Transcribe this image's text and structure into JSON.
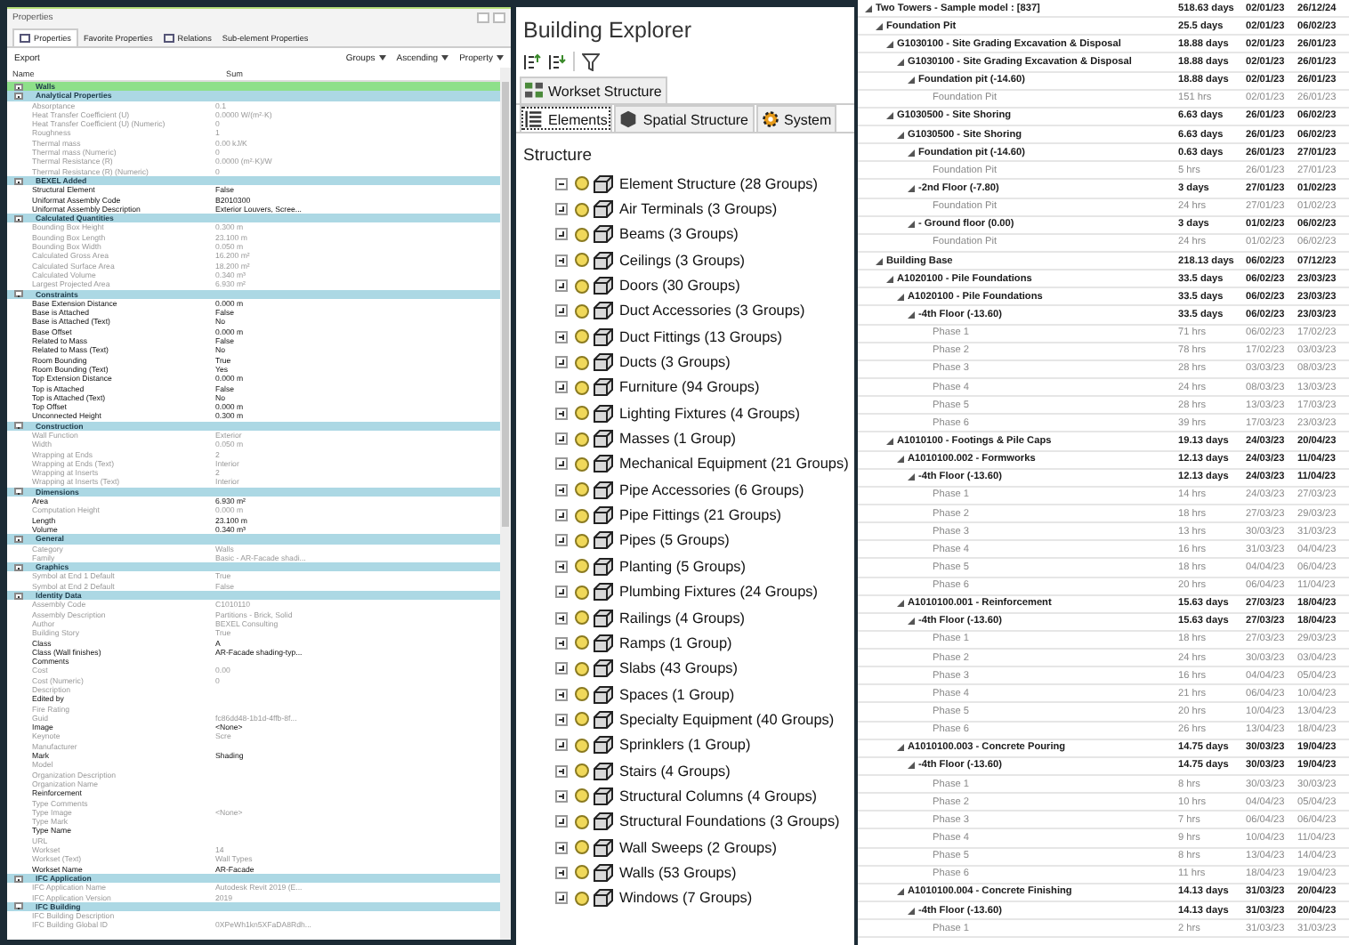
{
  "properties_panel": {
    "title": "Properties",
    "tabs": [
      {
        "label": "Properties",
        "selected": true
      },
      {
        "label": "Favorite Properties",
        "selected": false
      },
      {
        "label": "Relations",
        "selected": false
      },
      {
        "label": "Sub-element Properties",
        "selected": false
      }
    ],
    "export": "Export",
    "tools": [
      "Groups",
      "Ascending",
      "Property"
    ],
    "columns": [
      "Name",
      "Sum"
    ],
    "rows": [
      {
        "kind": "group",
        "label": "Walls",
        "color": "#8ee08a",
        "expanded": true
      },
      {
        "kind": "group",
        "label": "Analytical Properties",
        "color": "#acd8e4",
        "expanded": true
      },
      {
        "kind": "property",
        "name": "Absorptance",
        "value": "0.1",
        "disabled": true
      },
      {
        "kind": "property",
        "name": "Heat Transfer Coefficient (U)",
        "value": "0.0000 W/(m²·K)",
        "disabled": true
      },
      {
        "kind": "property",
        "name": "Heat Transfer Coefficient (U) (Numeric)",
        "value": "0",
        "disabled": true
      },
      {
        "kind": "property",
        "name": "Roughness",
        "value": "1",
        "disabled": true
      },
      {
        "kind": "property",
        "name": "Thermal mass",
        "value": "0.00 kJ/K",
        "disabled": true
      },
      {
        "kind": "property",
        "name": "Thermal mass (Numeric)",
        "value": "0",
        "disabled": true
      },
      {
        "kind": "property",
        "name": "Thermal Resistance (R)",
        "value": "0.0000 (m²·K)/W",
        "disabled": true
      },
      {
        "kind": "property",
        "name": "Thermal Resistance (R) (Numeric)",
        "value": "0",
        "disabled": true
      },
      {
        "kind": "group",
        "label": "BEXEL Added",
        "color": "#acd8e4",
        "expanded": true
      },
      {
        "kind": "property",
        "name": "Structural Element",
        "value": "False",
        "disabled": false
      },
      {
        "kind": "property",
        "name": "Uniformat Assembly Code",
        "value": "B2010300",
        "disabled": false
      },
      {
        "kind": "property",
        "name": "Uniformat Assembly Description",
        "value": "Exterior Louvers, Scree...",
        "disabled": false
      },
      {
        "kind": "group",
        "label": "Calculated Quantities",
        "color": "#acd8e4",
        "expanded": true
      },
      {
        "kind": "property",
        "name": "Bounding Box Height",
        "value": "0.300 m",
        "disabled": true
      },
      {
        "kind": "property",
        "name": "Bounding Box Length",
        "value": "23.100 m",
        "disabled": true
      },
      {
        "kind": "property",
        "name": "Bounding Box Width",
        "value": "0.050 m",
        "disabled": true
      },
      {
        "kind": "property",
        "name": "Calculated Gross Area",
        "value": "16.200 m²",
        "disabled": true
      },
      {
        "kind": "property",
        "name": "Calculated Surface Area",
        "value": "18.200 m²",
        "disabled": true
      },
      {
        "kind": "property",
        "name": "Calculated Volume",
        "value": "0.340 m³",
        "disabled": true
      },
      {
        "kind": "property",
        "name": "Largest Projected Area",
        "value": "6.930 m²",
        "disabled": true
      },
      {
        "kind": "group",
        "label": "Constraints",
        "color": "#acd8e4",
        "expanded": true
      },
      {
        "kind": "property",
        "name": "Base Extension Distance",
        "value": "0.000 m",
        "disabled": false
      },
      {
        "kind": "property",
        "name": "Base is Attached",
        "value": "False",
        "disabled": false
      },
      {
        "kind": "property",
        "name": "Base is Attached (Text)",
        "value": "No",
        "disabled": false
      },
      {
        "kind": "property",
        "name": "Base Offset",
        "value": "0.000 m",
        "disabled": false
      },
      {
        "kind": "property",
        "name": "Related to Mass",
        "value": "False",
        "disabled": false
      },
      {
        "kind": "property",
        "name": "Related to Mass (Text)",
        "value": "No",
        "disabled": false
      },
      {
        "kind": "property",
        "name": "Room Bounding",
        "value": "True",
        "disabled": false
      },
      {
        "kind": "property",
        "name": "Room Bounding (Text)",
        "value": "Yes",
        "disabled": false
      },
      {
        "kind": "property",
        "name": "Top Extension Distance",
        "value": "0.000 m",
        "disabled": false
      },
      {
        "kind": "property",
        "name": "Top is Attached",
        "value": "False",
        "disabled": false
      },
      {
        "kind": "property",
        "name": "Top is Attached (Text)",
        "value": "No",
        "disabled": false
      },
      {
        "kind": "property",
        "name": "Top Offset",
        "value": "0.000 m",
        "disabled": false
      },
      {
        "kind": "property",
        "name": "Unconnected Height",
        "value": "0.300 m",
        "disabled": false
      },
      {
        "kind": "group",
        "label": "Construction",
        "color": "#acd8e4",
        "expanded": true
      },
      {
        "kind": "property",
        "name": "Wall Function",
        "value": "Exterior",
        "disabled": true
      },
      {
        "kind": "property",
        "name": "Width",
        "value": "0.050 m",
        "disabled": true
      },
      {
        "kind": "property",
        "name": "Wrapping at Ends",
        "value": "2",
        "disabled": true
      },
      {
        "kind": "property",
        "name": "Wrapping at Ends (Text)",
        "value": "Interior",
        "disabled": true
      },
      {
        "kind": "property",
        "name": "Wrapping at Inserts",
        "value": "2",
        "disabled": true
      },
      {
        "kind": "property",
        "name": "Wrapping at Inserts (Text)",
        "value": "Interior",
        "disabled": true
      },
      {
        "kind": "group",
        "label": "Dimensions",
        "color": "#acd8e4",
        "expanded": true
      },
      {
        "kind": "property",
        "name": "Area",
        "value": "6.930 m²",
        "disabled": false
      },
      {
        "kind": "property",
        "name": "Computation Height",
        "value": "0.000 m",
        "disabled": true
      },
      {
        "kind": "property",
        "name": "Length",
        "value": "23.100 m",
        "disabled": false
      },
      {
        "kind": "property",
        "name": "Volume",
        "value": "0.340 m³",
        "disabled": false
      },
      {
        "kind": "group",
        "label": "General",
        "color": "#acd8e4",
        "expanded": true
      },
      {
        "kind": "property",
        "name": "Category",
        "value": "Walls",
        "disabled": true
      },
      {
        "kind": "property",
        "name": "Family",
        "value": "Basic - AR-Facade shadi...",
        "disabled": true
      },
      {
        "kind": "group",
        "label": "Graphics",
        "color": "#acd8e4",
        "expanded": true
      },
      {
        "kind": "property",
        "name": "Symbol at End 1 Default",
        "value": "True",
        "disabled": true
      },
      {
        "kind": "property",
        "name": "Symbol at End 2 Default",
        "value": "False",
        "disabled": true
      },
      {
        "kind": "group",
        "label": "Identity Data",
        "color": "#acd8e4",
        "expanded": true
      },
      {
        "kind": "property",
        "name": "Assembly Code",
        "value": "C1010110",
        "disabled": true
      },
      {
        "kind": "property",
        "name": "Assembly Description",
        "value": "Partitions - Brick, Solid",
        "disabled": true
      },
      {
        "kind": "property",
        "name": "Author",
        "value": "BEXEL Consulting",
        "disabled": true
      },
      {
        "kind": "property",
        "name": "Building Story",
        "value": "True",
        "disabled": true
      },
      {
        "kind": "property",
        "name": "Class",
        "value": "A",
        "disabled": false
      },
      {
        "kind": "property",
        "name": "Class (Wall finishes)",
        "value": "AR-Facade shading-typ...",
        "disabled": false
      },
      {
        "kind": "property",
        "name": "Comments",
        "disabled": false
      },
      {
        "kind": "property",
        "name": "Cost",
        "value": "0.00",
        "disabled": true
      },
      {
        "kind": "property",
        "name": "Cost (Numeric)",
        "value": "0",
        "disabled": true
      },
      {
        "kind": "property",
        "name": "Description",
        "disabled": true
      },
      {
        "kind": "property",
        "name": "Edited by",
        "disabled": false
      },
      {
        "kind": "property",
        "name": "Fire Rating",
        "disabled": true
      },
      {
        "kind": "property",
        "name": "Guid",
        "value": "fc86dd48-1b1d-4ffb-8f...",
        "disabled": true
      },
      {
        "kind": "property",
        "name": "Image",
        "value": "<None>",
        "disabled": false
      },
      {
        "kind": "property",
        "name": "Keynote",
        "value": "Scre",
        "disabled": true
      },
      {
        "kind": "property",
        "name": "Manufacturer",
        "disabled": true
      },
      {
        "kind": "property",
        "name": "Mark",
        "value": "Shading",
        "disabled": false
      },
      {
        "kind": "property",
        "name": "Model",
        "disabled": true
      },
      {
        "kind": "property",
        "name": "Organization Description",
        "disabled": true
      },
      {
        "kind": "property",
        "name": "Organization Name",
        "disabled": true
      },
      {
        "kind": "property",
        "name": "Reinforcement",
        "disabled": false
      },
      {
        "kind": "property",
        "name": "Type Comments",
        "disabled": true
      },
      {
        "kind": "property",
        "name": "Type Image",
        "value": "<None>",
        "disabled": true
      },
      {
        "kind": "property",
        "name": "Type Mark",
        "disabled": true
      },
      {
        "kind": "property",
        "name": "Type Name",
        "disabled": false
      },
      {
        "kind": "property",
        "name": "URL",
        "disabled": true
      },
      {
        "kind": "property",
        "name": "Workset",
        "value": "14",
        "disabled": true
      },
      {
        "kind": "property",
        "name": "Workset (Text)",
        "value": "Wall Types",
        "disabled": true
      },
      {
        "kind": "property",
        "name": "Workset Name",
        "value": "AR-Facade",
        "disabled": false
      },
      {
        "kind": "group",
        "label": "IFC Application",
        "color": "#acd8e4",
        "expanded": true
      },
      {
        "kind": "property",
        "name": "IFC Application Name",
        "value": "Autodesk Revit 2019 (E...",
        "disabled": true
      },
      {
        "kind": "property",
        "name": "IFC Application Version",
        "value": "2019",
        "disabled": true
      },
      {
        "kind": "group",
        "label": "IFC Building",
        "color": "#acd8e4",
        "expanded": true
      },
      {
        "kind": "property",
        "name": "IFC Building Description",
        "disabled": true
      },
      {
        "kind": "property",
        "name": "IFC Building Global ID",
        "value": "0XPeWh1kn5XFaDA8Rdh...",
        "disabled": true
      }
    ]
  },
  "building_explorer": {
    "title": "Building Explorer",
    "tab_rows": [
      [
        {
          "label": "Workset Structure",
          "selected": false
        }
      ],
      [
        {
          "label": "Elements",
          "selected": true
        },
        {
          "label": "Spatial Structure",
          "selected": false
        },
        {
          "label": "System",
          "selected": false
        }
      ]
    ],
    "section": "Structure",
    "tree": {
      "label": "Element Structure (28 Groups)",
      "expanded": true,
      "children": [
        {
          "label": "Air Terminals (3 Groups)",
          "expanded": false
        },
        {
          "label": "Beams (3 Groups)",
          "expanded": false
        },
        {
          "label": "Ceilings (3 Groups)",
          "expanded": false
        },
        {
          "label": "Doors (30 Groups)",
          "expanded": false
        },
        {
          "label": "Duct Accessories (3 Groups)",
          "expanded": false
        },
        {
          "label": "Duct Fittings (13 Groups)",
          "expanded": false
        },
        {
          "label": "Ducts (3 Groups)",
          "expanded": false
        },
        {
          "label": "Furniture (94 Groups)",
          "expanded": false
        },
        {
          "label": "Lighting Fixtures (4 Groups)",
          "expanded": false
        },
        {
          "label": "Masses (1 Group)",
          "expanded": false
        },
        {
          "label": "Mechanical Equipment (21 Groups)",
          "expanded": false
        },
        {
          "label": "Pipe Accessories (6 Groups)",
          "expanded": false
        },
        {
          "label": "Pipe Fittings (21 Groups)",
          "expanded": false
        },
        {
          "label": "Pipes (5 Groups)",
          "expanded": false
        },
        {
          "label": "Planting (5 Groups)",
          "expanded": false
        },
        {
          "label": "Plumbing Fixtures (24 Groups)",
          "expanded": false
        },
        {
          "label": "Railings (4 Groups)",
          "expanded": false
        },
        {
          "label": "Ramps (1 Group)",
          "expanded": false
        },
        {
          "label": "Slabs (43 Groups)",
          "expanded": false
        },
        {
          "label": "Spaces (1 Group)",
          "expanded": false
        },
        {
          "label": "Specialty Equipment (40 Groups)",
          "expanded": false
        },
        {
          "label": "Sprinklers (1 Group)",
          "expanded": false
        },
        {
          "label": "Stairs (4 Groups)",
          "expanded": false
        },
        {
          "label": "Structural Columns (4 Groups)",
          "expanded": false
        },
        {
          "label": "Structural Foundations (3 Groups)",
          "expanded": false
        },
        {
          "label": "Wall Sweeps (2 Groups)",
          "expanded": false
        },
        {
          "label": "Walls (53 Groups)",
          "expanded": false
        },
        {
          "label": "Windows (7 Groups)",
          "expanded": false
        }
      ]
    }
  },
  "schedule": {
    "rows": [
      {
        "name": "Two Towers - Sample model : [837]",
        "duration": "518.63 days",
        "start": "02/01/23",
        "finish": "26/12/24",
        "children": [
          {
            "name": "Foundation Pit",
            "duration": "25.5 days",
            "start": "02/01/23",
            "finish": "06/02/23",
            "children": [
              {
                "name": "G1030100 - Site Grading Excavation & Disposal",
                "duration": "18.88 days",
                "start": "02/01/23",
                "finish": "26/01/23",
                "children": [
                  {
                    "name": "G1030100 - Site Grading Excavation & Disposal",
                    "duration": "18.88 days",
                    "start": "02/01/23",
                    "finish": "26/01/23",
                    "children": [
                      {
                        "name": "Foundation pit (-14.60)",
                        "duration": "18.88 days",
                        "start": "02/01/23",
                        "finish": "26/01/23",
                        "children": [
                          {
                            "name": "Foundation Pit",
                            "duration": "151 hrs",
                            "start": "02/01/23",
                            "finish": "26/01/23"
                          }
                        ]
                      }
                    ]
                  }
                ]
              },
              {
                "name": "G1030500 - Site Shoring",
                "duration": "6.63 days",
                "start": "26/01/23",
                "finish": "06/02/23",
                "children": [
                  {
                    "name": "G1030500 - Site Shoring",
                    "duration": "6.63 days",
                    "start": "26/01/23",
                    "finish": "06/02/23",
                    "children": [
                      {
                        "name": "Foundation pit (-14.60)",
                        "duration": "0.63 days",
                        "start": "26/01/23",
                        "finish": "27/01/23",
                        "children": [
                          {
                            "name": "Foundation Pit",
                            "duration": "5 hrs",
                            "start": "26/01/23",
                            "finish": "27/01/23"
                          }
                        ]
                      },
                      {
                        "name": "-2nd Floor (-7.80)",
                        "duration": "3 days",
                        "start": "27/01/23",
                        "finish": "01/02/23",
                        "children": [
                          {
                            "name": "Foundation Pit",
                            "duration": "24 hrs",
                            "start": "27/01/23",
                            "finish": "01/02/23"
                          }
                        ]
                      },
                      {
                        "name": "- Ground floor (0.00)",
                        "duration": "3 days",
                        "start": "01/02/23",
                        "finish": "06/02/23",
                        "children": [
                          {
                            "name": "Foundation Pit",
                            "duration": "24 hrs",
                            "start": "01/02/23",
                            "finish": "06/02/23"
                          }
                        ]
                      }
                    ]
                  }
                ]
              }
            ]
          },
          {
            "name": "Building Base",
            "duration": "218.13 days",
            "start": "06/02/23",
            "finish": "07/12/23",
            "children": [
              {
                "name": "A1020100 - Pile Foundations",
                "duration": "33.5 days",
                "start": "06/02/23",
                "finish": "23/03/23",
                "children": [
                  {
                    "name": "A1020100 - Pile Foundations",
                    "duration": "33.5 days",
                    "start": "06/02/23",
                    "finish": "23/03/23",
                    "children": [
                      {
                        "name": "-4th Floor (-13.60)",
                        "duration": "33.5 days",
                        "start": "06/02/23",
                        "finish": "23/03/23",
                        "children": [
                          {
                            "name": "Phase 1",
                            "duration": "71 hrs",
                            "start": "06/02/23",
                            "finish": "17/02/23"
                          },
                          {
                            "name": "Phase 2",
                            "duration": "78 hrs",
                            "start": "17/02/23",
                            "finish": "03/03/23"
                          },
                          {
                            "name": "Phase 3",
                            "duration": "28 hrs",
                            "start": "03/03/23",
                            "finish": "08/03/23"
                          },
                          {
                            "name": "Phase 4",
                            "duration": "24 hrs",
                            "start": "08/03/23",
                            "finish": "13/03/23"
                          },
                          {
                            "name": "Phase 5",
                            "duration": "28 hrs",
                            "start": "13/03/23",
                            "finish": "17/03/23"
                          },
                          {
                            "name": "Phase 6",
                            "duration": "39 hrs",
                            "start": "17/03/23",
                            "finish": "23/03/23"
                          }
                        ]
                      }
                    ]
                  }
                ]
              },
              {
                "name": "A1010100 - Footings & Pile Caps",
                "duration": "19.13 days",
                "start": "24/03/23",
                "finish": "20/04/23",
                "children": [
                  {
                    "name": "A1010100.002 - Formworks",
                    "duration": "12.13 days",
                    "start": "24/03/23",
                    "finish": "11/04/23",
                    "children": [
                      {
                        "name": "-4th Floor (-13.60)",
                        "duration": "12.13 days",
                        "start": "24/03/23",
                        "finish": "11/04/23",
                        "children": [
                          {
                            "name": "Phase 1",
                            "duration": "14 hrs",
                            "start": "24/03/23",
                            "finish": "27/03/23"
                          },
                          {
                            "name": "Phase 2",
                            "duration": "18 hrs",
                            "start": "27/03/23",
                            "finish": "29/03/23"
                          },
                          {
                            "name": "Phase 3",
                            "duration": "13 hrs",
                            "start": "30/03/23",
                            "finish": "31/03/23"
                          },
                          {
                            "name": "Phase 4",
                            "duration": "16 hrs",
                            "start": "31/03/23",
                            "finish": "04/04/23"
                          },
                          {
                            "name": "Phase 5",
                            "duration": "18 hrs",
                            "start": "04/04/23",
                            "finish": "06/04/23"
                          },
                          {
                            "name": "Phase 6",
                            "duration": "20 hrs",
                            "start": "06/04/23",
                            "finish": "11/04/23"
                          }
                        ]
                      }
                    ]
                  },
                  {
                    "name": "A1010100.001 - Reinforcement",
                    "duration": "15.63 days",
                    "start": "27/03/23",
                    "finish": "18/04/23",
                    "children": [
                      {
                        "name": "-4th Floor (-13.60)",
                        "duration": "15.63 days",
                        "start": "27/03/23",
                        "finish": "18/04/23",
                        "children": [
                          {
                            "name": "Phase 1",
                            "duration": "18 hrs",
                            "start": "27/03/23",
                            "finish": "29/03/23"
                          },
                          {
                            "name": "Phase 2",
                            "duration": "24 hrs",
                            "start": "30/03/23",
                            "finish": "03/04/23"
                          },
                          {
                            "name": "Phase 3",
                            "duration": "16 hrs",
                            "start": "04/04/23",
                            "finish": "05/04/23"
                          },
                          {
                            "name": "Phase 4",
                            "duration": "21 hrs",
                            "start": "06/04/23",
                            "finish": "10/04/23"
                          },
                          {
                            "name": "Phase 5",
                            "duration": "20 hrs",
                            "start": "10/04/23",
                            "finish": "13/04/23"
                          },
                          {
                            "name": "Phase 6",
                            "duration": "26 hrs",
                            "start": "13/04/23",
                            "finish": "18/04/23"
                          }
                        ]
                      }
                    ]
                  },
                  {
                    "name": "A1010100.003 - Concrete Pouring",
                    "duration": "14.75 days",
                    "start": "30/03/23",
                    "finish": "19/04/23",
                    "children": [
                      {
                        "name": "-4th Floor (-13.60)",
                        "duration": "14.75 days",
                        "start": "30/03/23",
                        "finish": "19/04/23",
                        "children": [
                          {
                            "name": "Phase 1",
                            "duration": "8 hrs",
                            "start": "30/03/23",
                            "finish": "30/03/23"
                          },
                          {
                            "name": "Phase 2",
                            "duration": "10 hrs",
                            "start": "04/04/23",
                            "finish": "05/04/23"
                          },
                          {
                            "name": "Phase 3",
                            "duration": "7 hrs",
                            "start": "06/04/23",
                            "finish": "06/04/23"
                          },
                          {
                            "name": "Phase 4",
                            "duration": "9 hrs",
                            "start": "10/04/23",
                            "finish": "11/04/23"
                          },
                          {
                            "name": "Phase 5",
                            "duration": "8 hrs",
                            "start": "13/04/23",
                            "finish": "14/04/23"
                          },
                          {
                            "name": "Phase 6",
                            "duration": "11 hrs",
                            "start": "18/04/23",
                            "finish": "19/04/23"
                          }
                        ]
                      }
                    ]
                  },
                  {
                    "name": "A1010100.004 - Concrete Finishing",
                    "duration": "14.13 days",
                    "start": "31/03/23",
                    "finish": "20/04/23",
                    "children": [
                      {
                        "name": "-4th Floor (-13.60)",
                        "duration": "14.13 days",
                        "start": "31/03/23",
                        "finish": "20/04/23",
                        "children": [
                          {
                            "name": "Phase 1",
                            "duration": "2 hrs",
                            "start": "31/03/23",
                            "finish": "31/03/23"
                          }
                        ]
                      }
                    ]
                  }
                ]
              }
            ]
          }
        ]
      }
    ]
  }
}
